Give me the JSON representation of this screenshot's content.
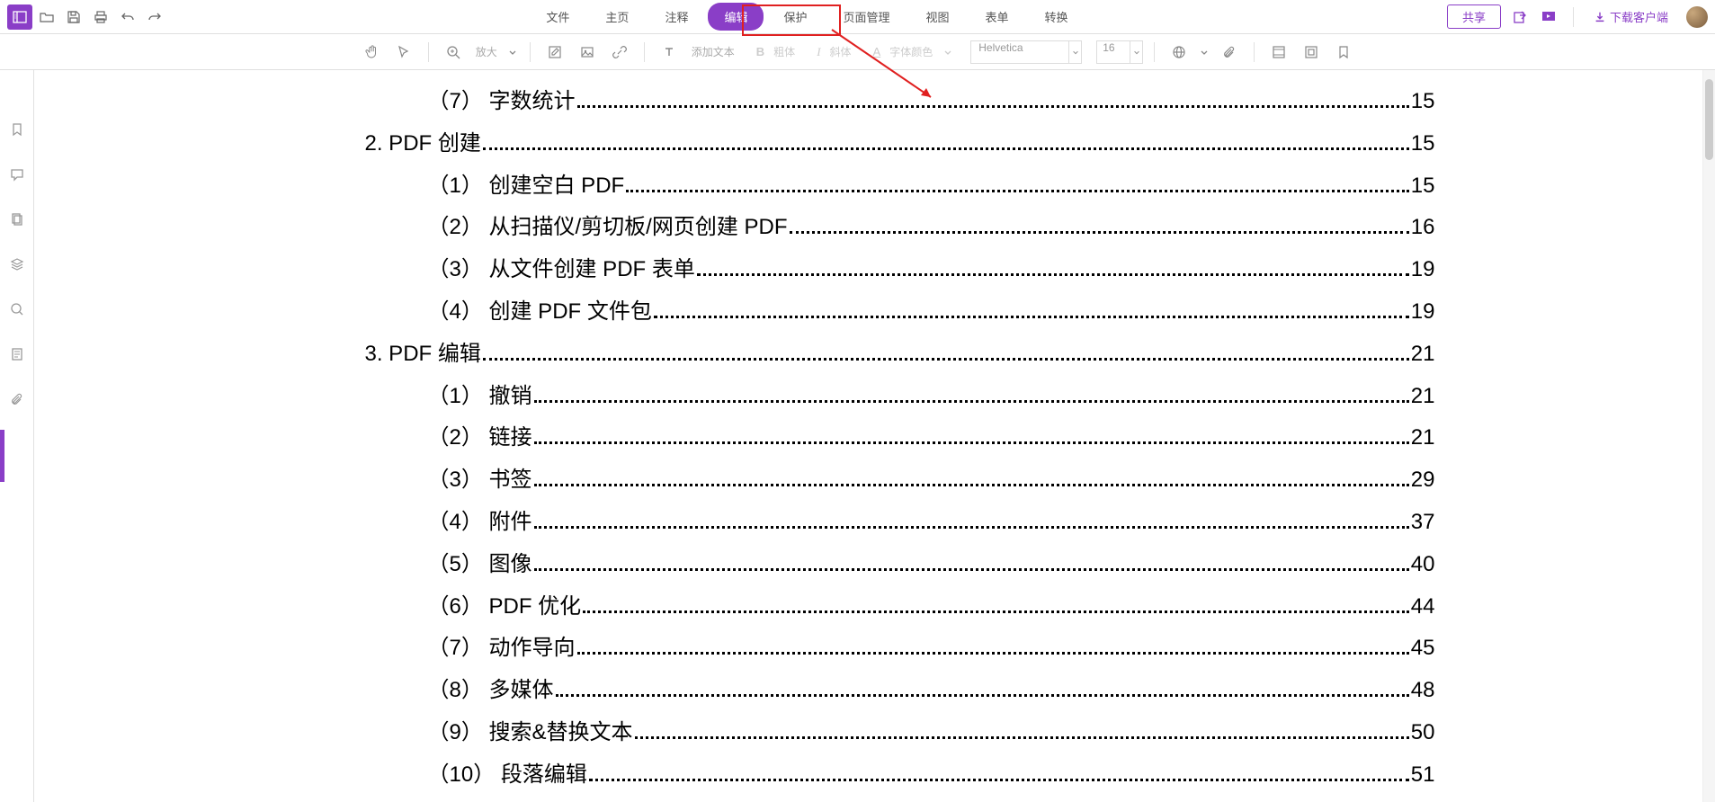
{
  "topbar": {
    "share": "共享",
    "download": "下载客户端"
  },
  "menu": {
    "file": "文件",
    "home": "主页",
    "annotate": "注释",
    "edit": "编辑",
    "protect": "保护",
    "pages": "页面管理",
    "view": "视图",
    "form": "表单",
    "convert": "转换"
  },
  "tools": {
    "zoom": "放大",
    "add_text": "添加文本",
    "bold": "粗体",
    "italic": "斜体",
    "font_color": "字体颜色",
    "font": "Helvetica",
    "size": "16"
  },
  "toc": [
    {
      "indent": 2,
      "title": "（7）  字数统计",
      "page": "15"
    },
    {
      "indent": 1,
      "title": "2.  PDF 创建",
      "page": "15"
    },
    {
      "indent": 2,
      "title": "（1） 创建空白 PDF",
      "page": "15"
    },
    {
      "indent": 2,
      "title": "（2） 从扫描仪/剪切板/网页创建 PDF",
      "page": " 16"
    },
    {
      "indent": 2,
      "title": "（3） 从文件创建 PDF 表单",
      "page": "19"
    },
    {
      "indent": 2,
      "title": "（4） 创建 PDF 文件包",
      "page": "19"
    },
    {
      "indent": 1,
      "title": "3.  PDF 编辑",
      "page": "21"
    },
    {
      "indent": 2,
      "title": "（1）  撤销",
      "page": "21"
    },
    {
      "indent": 2,
      "title": "（2）  链接",
      "page": "21"
    },
    {
      "indent": 2,
      "title": "（3）  书签",
      "page": "29"
    },
    {
      "indent": 2,
      "title": "（4）  附件",
      "page": "37"
    },
    {
      "indent": 2,
      "title": "（5）  图像",
      "page": "40"
    },
    {
      "indent": 2,
      "title": "（6）  PDF 优化",
      "page": "44"
    },
    {
      "indent": 2,
      "title": "（7）  动作导向",
      "page": "45"
    },
    {
      "indent": 2,
      "title": "（8）  多媒体",
      "page": "48"
    },
    {
      "indent": 2,
      "title": "（9）  搜索&替换文本",
      "page": "50"
    },
    {
      "indent": 2,
      "title": "（10）  段落编辑",
      "page": "51"
    }
  ]
}
